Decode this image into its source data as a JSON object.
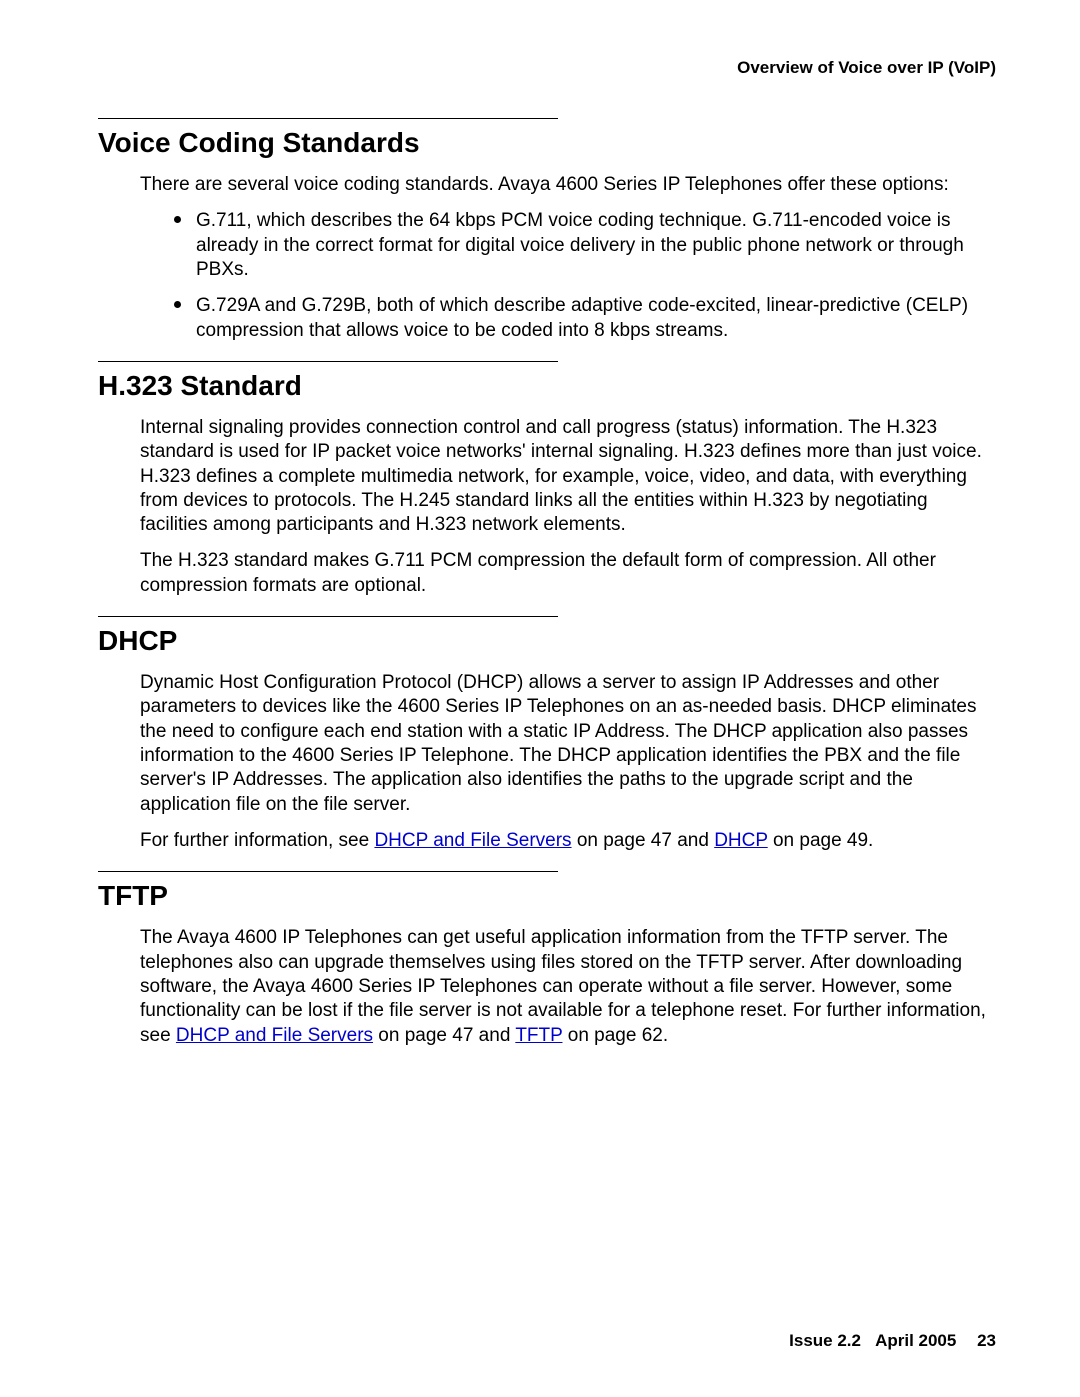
{
  "running_head": "Overview of Voice over IP (VoIP)",
  "sections": {
    "voice_coding": {
      "title": "Voice Coding Standards",
      "intro": "There are several voice coding standards. Avaya 4600 Series IP Telephones offer these options:",
      "bullets": [
        "G.711, which describes the 64 kbps PCM voice coding technique. G.711-encoded voice is already in the correct format for digital voice delivery in the public phone network or through PBXs.",
        "G.729A and G.729B, both of which describe adaptive code-excited, linear-predictive (CELP) compression that allows voice to be coded into 8 kbps streams."
      ]
    },
    "h323": {
      "title": "H.323 Standard",
      "p1": "Internal signaling provides connection control and call progress (status) information. The H.323 standard is used for IP packet voice networks' internal signaling. H.323 defines more than just voice. H.323 defines a complete multimedia network, for example, voice, video, and data, with everything from devices to protocols. The H.245 standard links all the entities within H.323 by negotiating facilities among participants and H.323 network elements.",
      "p2": "The H.323 standard makes G.711 PCM compression the default form of compression. All other compression formats are optional."
    },
    "dhcp": {
      "title": "DHCP",
      "p1": "Dynamic Host Configuration Protocol (DHCP) allows a server to assign IP Addresses and other parameters to devices like the 4600 Series IP Telephones on an as-needed basis. DHCP eliminates the need to configure each end station with a static IP Address. The DHCP application also passes information to the 4600 Series IP Telephone. The DHCP application identifies the PBX and the file server's IP Addresses. The application also identifies the paths to the upgrade script and the application file on the file server.",
      "p2_pre": "For further information, see ",
      "link1": "DHCP and File Servers",
      "p2_mid": " on page 47 and ",
      "link2": "DHCP",
      "p2_post": " on page 49."
    },
    "tftp": {
      "title": "TFTP",
      "p1_pre": "The Avaya 4600 IP Telephones can get useful application information from the TFTP server. The telephones also can upgrade themselves using files stored on the TFTP server. After downloading software, the Avaya 4600 Series IP Telephones can operate without a file server. However, some functionality can be lost if the file server is not available for a telephone reset. For further information, see ",
      "link1": "DHCP and File Servers",
      "p1_mid": " on page 47 and ",
      "link2": "TFTP",
      "p1_post": " on page 62."
    }
  },
  "footer": {
    "issue": "Issue 2.2",
    "date": "April 2005",
    "page": "23"
  }
}
